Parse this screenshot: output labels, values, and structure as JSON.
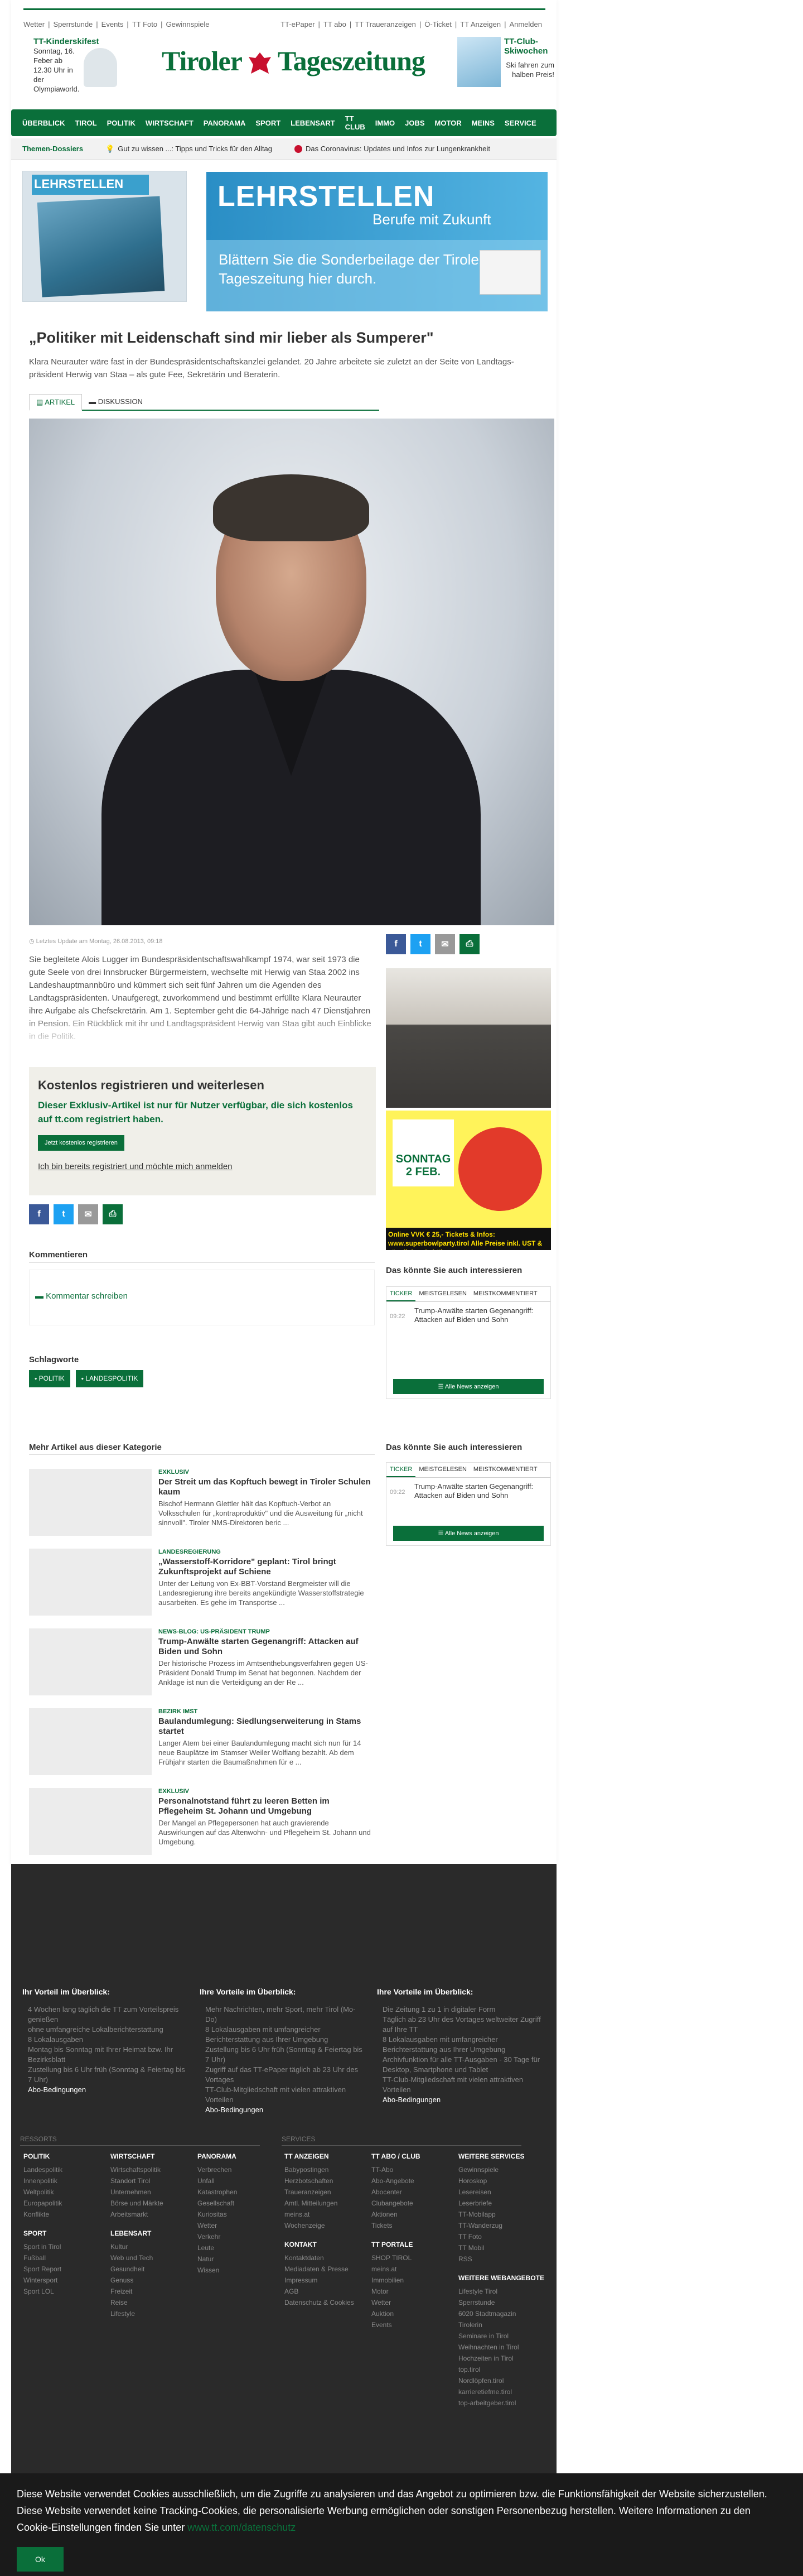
{
  "topbar": {
    "left": [
      "Wetter",
      "Sperrstunde",
      "Events",
      "TT Foto",
      "Gewinnspiele"
    ],
    "right": [
      "TT-ePaper",
      "TT abo",
      "TT Traueranzeigen",
      "Ö-Ticket",
      "TT Anzeigen",
      "Anmelden"
    ]
  },
  "promo_left": {
    "title": "TT-Kinderskifest",
    "text": "Sonntag, 16. Feber ab 12.30 Uhr in der Olympiaworld."
  },
  "logo": {
    "left": "Tiroler",
    "right": "Tageszeitung"
  },
  "promo_right": {
    "title": "TT-Club-Skiwochen",
    "text": "Ski fahren zum halben Preis!"
  },
  "nav": {
    "left": [
      "ÜBERBLICK",
      "TIROL",
      "POLITIK",
      "WIRTSCHAFT",
      "PANORAMA",
      "SPORT",
      "LEBENSART"
    ],
    "right": [
      "TT CLUB",
      "IMMO",
      "JOBS",
      "MOTOR",
      "MEINS",
      "SERVICE"
    ]
  },
  "themes": {
    "head": "Themen-Dossiers",
    "items": [
      "Gut zu wissen ...: Tipps und Tricks für den Alltag",
      "Das Coronavirus: Updates und Infos zur Lungenkrankheit"
    ]
  },
  "banner": {
    "mag": "LEHRSTELLEN",
    "title": "LEHRSTELLEN",
    "sub": "Berufe mit Zukunft",
    "text": "Blättern Sie die Sonderbeilage der Tiroler Tageszeitung hier durch."
  },
  "article": {
    "title": "„Politiker mit Leidenschaft sind mir lieber als Sumperer\"",
    "lead": "Klara Neurauter wäre fast in der Bundespräsidentschaftskanzlei gelandet. 20 Jahre arbeitete sie zuletzt an der Seite von Landtags-präsident Herwig van Staa – als gute Fee, Sekretärin und Beraterin.",
    "tab_article": "ARTIKEL",
    "tab_discussion": "DISKUSSION",
    "updated": "Letztes Update am Montag, 26.08.2013, 09:18",
    "body": "Sie begleitete Alois Lugger im Bundespräsidentschaftswahlkampf 1974, war seit 1973 die gute Seele von drei Innsbrucker Bürgermeistern, wechselte mit Herwig van Staa 2002 ins Landeshauptmannbüro und kümmert sich seit fünf Jahren um die Agenden des Landtagspräsidenten. Unaufgeregt, zuvorkommend und bestimmt erfüllte Klara Neurauter ihre Aufgabe als Chefsekretärin. Am 1. September geht die 64-Jährige nach 47 Dienstjahren in Pension. Ein Rückblick mit ihr und Landtagspräsident Herwig van Staa gibt auch Einblicke in die Politik."
  },
  "paywall": {
    "title": "Kostenlos registrieren und weiterlesen",
    "text": "Dieser Exklusiv-Artikel ist nur für Nutzer verfügbar, die sich kostenlos auf tt.com registriert haben.",
    "button": "Jetzt kostenlos registrieren",
    "login": "Ich bin bereits registriert und möchte mich anmelden"
  },
  "comments": {
    "head": "Kommentieren",
    "link": "Kommentar schreiben"
  },
  "tags": {
    "head": "Schlagworte",
    "items": [
      "POLITIK",
      "LANDESPOLITIK"
    ]
  },
  "share": [
    "f",
    "t",
    "✉",
    "⎙"
  ],
  "sidebar": {
    "head": "Das könnte Sie auch interessieren",
    "tabs": [
      "TICKER",
      "MEISTGELESEN",
      "MEISTKOMMENTIERT"
    ],
    "time": "09:22",
    "item": "Trump-Anwälte starten Gegenangriff: Attacken auf Biden und Sohn",
    "button": "Alle News anzeigen",
    "ad_text": "Online VVK € 25,- Tickets & Infos: www.superbowlparty.tirol Alle Preise inkl. UST & sämtlicher Gebühren",
    "ad_date": "SONNTAG 2 FEB."
  },
  "more": {
    "head": "Mehr Artikel aus dieser Kategorie",
    "items": [
      {
        "kicker": "EXKLUSIV",
        "title": "Der Streit um das Kopftuch bewegt in Tiroler Schulen kaum",
        "desc": "Bischof Hermann Glettler hält das Kopftuch-Verbot an Volksschulen für „kontraproduktiv\" und die Ausweitung für „nicht sinnvoll\". Tiroler NMS-Direktoren beric ..."
      },
      {
        "kicker": "LANDESREGIERUNG",
        "title": "„Wasserstoff-Korridore\" geplant: Tirol bringt Zukunftsprojekt auf Schiene",
        "desc": "Unter der Leitung von Ex-BBT-Vorstand Bergmeister will die Landesregierung ihre bereits angekündigte Wasserstoffstrategie ausarbeiten. Es gehe im Transportse ..."
      },
      {
        "kicker": "NEWS-BLOG: US-PRÄSIDENT TRUMP",
        "title": "Trump-Anwälte starten Gegenangriff: Attacken auf Biden und Sohn",
        "desc": "Der historische Prozess im Amtsenthebungsverfahren gegen US-Präsident Donald Trump im Senat hat begonnen. Nachdem der Anklage ist nun die Verteidigung an der Re ..."
      },
      {
        "kicker": "BEZIRK IMST",
        "title": "Baulandumlegung: Siedlungserweiterung in Stams startet",
        "desc": "Langer Atem bei einer Baulandumlegung macht sich nun für 14 neue Bauplätze im Stamser Weiler Wolfiang bezahlt. Ab dem Frühjahr starten die Baumaßnahmen für e ..."
      },
      {
        "kicker": "EXKLUSIV",
        "title": "Personalnotstand führt zu leeren Betten im Pflegeheim St. Johann und Umgebung",
        "desc": "Der Mangel an Pflegepersonen hat auch gravierende Auswirkungen auf das Altenwohn- und Pflegeheim St. Johann und Umgebung."
      }
    ]
  },
  "footer": {
    "blocks": [
      {
        "title": "Ihr Vorteil im Überblick:",
        "items": [
          "4 Wochen lang täglich die TT zum Vorteilspreis genießen",
          "ohne umfangreiche Lokalberichterstattung",
          "8 Lokalausgaben",
          "Montag bis Sonntag mit Ihrer Heimat bzw. Ihr Bezirksblatt",
          "Zustellung bis 6 Uhr früh (Sonntag & Feiertag bis 7 Uhr)"
        ],
        "link": "Abo-Bedingungen"
      },
      {
        "title": "Ihre Vorteile im Überblick:",
        "items": [
          "Mehr Nachrichten, mehr Sport, mehr Tirol (Mo-Do)",
          "8 Lokalausgaben mit umfangreicher Berichterstattung aus Ihrer Umgebung",
          "Zustellung bis 6 Uhr früh (Sonntag & Feiertag bis 7 Uhr)",
          "Zugriff auf das TT-ePaper täglich ab 23 Uhr des Vortages",
          "TT-Club-Mitgliedschaft mit vielen attraktiven Vorteilen"
        ],
        "link": "Abo-Bedingungen"
      },
      {
        "title": "Ihre Vorteile im Überblick:",
        "items": [
          "Die Zeitung 1 zu 1 in digitaler Form",
          "Täglich ab 23 Uhr des Vortages weltweiter Zugriff auf Ihre TT",
          "8 Lokalausgaben mit umfangreicher Berichterstattung aus Ihrer Umgebung",
          "Archivfunktion für alle TT-Ausgaben - 30 Tage für Desktop, Smartphone und Tablet",
          "TT-Club-Mitgliedschaft mit vielen attraktiven Vorteilen"
        ],
        "link": "Abo-Bedingungen"
      }
    ],
    "sec1": "RESSORTS",
    "sec2": "SERVICES",
    "cols": [
      {
        "groups": [
          {
            "h": "POLITIK",
            "l": [
              "Landespolitik",
              "Innenpolitik",
              "Weltpolitik",
              "Europapolitik",
              "Konflikte"
            ]
          },
          {
            "h": "SPORT",
            "l": [
              "Sport in Tirol",
              "Fußball",
              "Sport Report",
              "Wintersport",
              "Sport LOL"
            ]
          }
        ]
      },
      {
        "groups": [
          {
            "h": "WIRTSCHAFT",
            "l": [
              "Wirtschaftspolitik",
              "Standort Tirol",
              "Unternehmen",
              "Börse und Märkte",
              "Arbeitsmarkt"
            ]
          },
          {
            "h": "LEBENSART",
            "l": [
              "Kultur",
              "Web und Tech",
              "Gesundheit",
              "Genuss",
              "Freizeit",
              "Reise",
              "Lifestyle"
            ]
          }
        ]
      },
      {
        "groups": [
          {
            "h": "PANORAMA",
            "l": [
              "Verbrechen",
              "Unfall",
              "Katastrophen",
              "Gesellschaft",
              "Kuriositas",
              "Wetter",
              "Verkehr",
              "Leute",
              "Natur",
              "Wissen"
            ]
          }
        ]
      },
      {
        "groups": [
          {
            "h": "TT ANZEIGEN",
            "l": [
              "Babypostingen",
              "Herzbotschaften",
              "Traueranzeigen",
              "Amtl. Mitteilungen",
              "meins.at",
              "Wochenzeige"
            ]
          },
          {
            "h": "KONTAKT",
            "l": [
              "Kontaktdaten",
              "Mediadaten & Presse",
              "Impressum",
              "AGB",
              "Datenschutz & Cookies"
            ]
          }
        ]
      },
      {
        "groups": [
          {
            "h": "TT ABO / CLUB",
            "l": [
              "TT-Abo",
              "Abo-Angebote",
              "Abocenter",
              "Clubangebote",
              "Aktionen",
              "Tickets"
            ]
          },
          {
            "h": "TT PORTALE",
            "l": [
              "SHOP TIROL",
              "meins.at",
              "Immobilien",
              "Motor",
              "Wetter",
              "Auktion",
              "Events"
            ]
          }
        ]
      },
      {
        "groups": [
          {
            "h": "WEITERE SERVICES",
            "l": [
              "Gewinnspiele",
              "Horoskop",
              "Lesereisen",
              "Leserbriefe",
              "TT-Mobilapp",
              "TT-Wanderzug",
              "TT Foto",
              "TT Mobil",
              "RSS"
            ]
          },
          {
            "h": "WEITERE WEBANGEBOTE",
            "l": [
              "Lifestyle Tirol",
              "Sperrstunde",
              "6020 Stadtmagazin",
              "Tirolerin",
              "Seminare in Tirol",
              "Weihnachten in Tirol",
              "Hochzeiten in Tirol",
              "top.tirol",
              "Nordlöpfen.tirol",
              "karrieretiefme.tirol",
              "top-arbeitgeber.tirol"
            ]
          }
        ]
      }
    ]
  },
  "cookie": {
    "line1": "Diese Website verwendet Cookies ausschließlich, um die Zugriffe zu analysieren und das Angebot zu optimieren bzw. die Funktionsfähigkeit der Website sicherzustellen.",
    "line2": "Diese Website verwendet keine Tracking-Cookies, die personalisierte Werbung ermöglichen oder sonstigen Personenbezug herstellen. Weitere Informationen zu den Cookie-Einstellungen finden Sie unter",
    "link": "www.tt.com/datenschutz",
    "ok": "Ok"
  }
}
